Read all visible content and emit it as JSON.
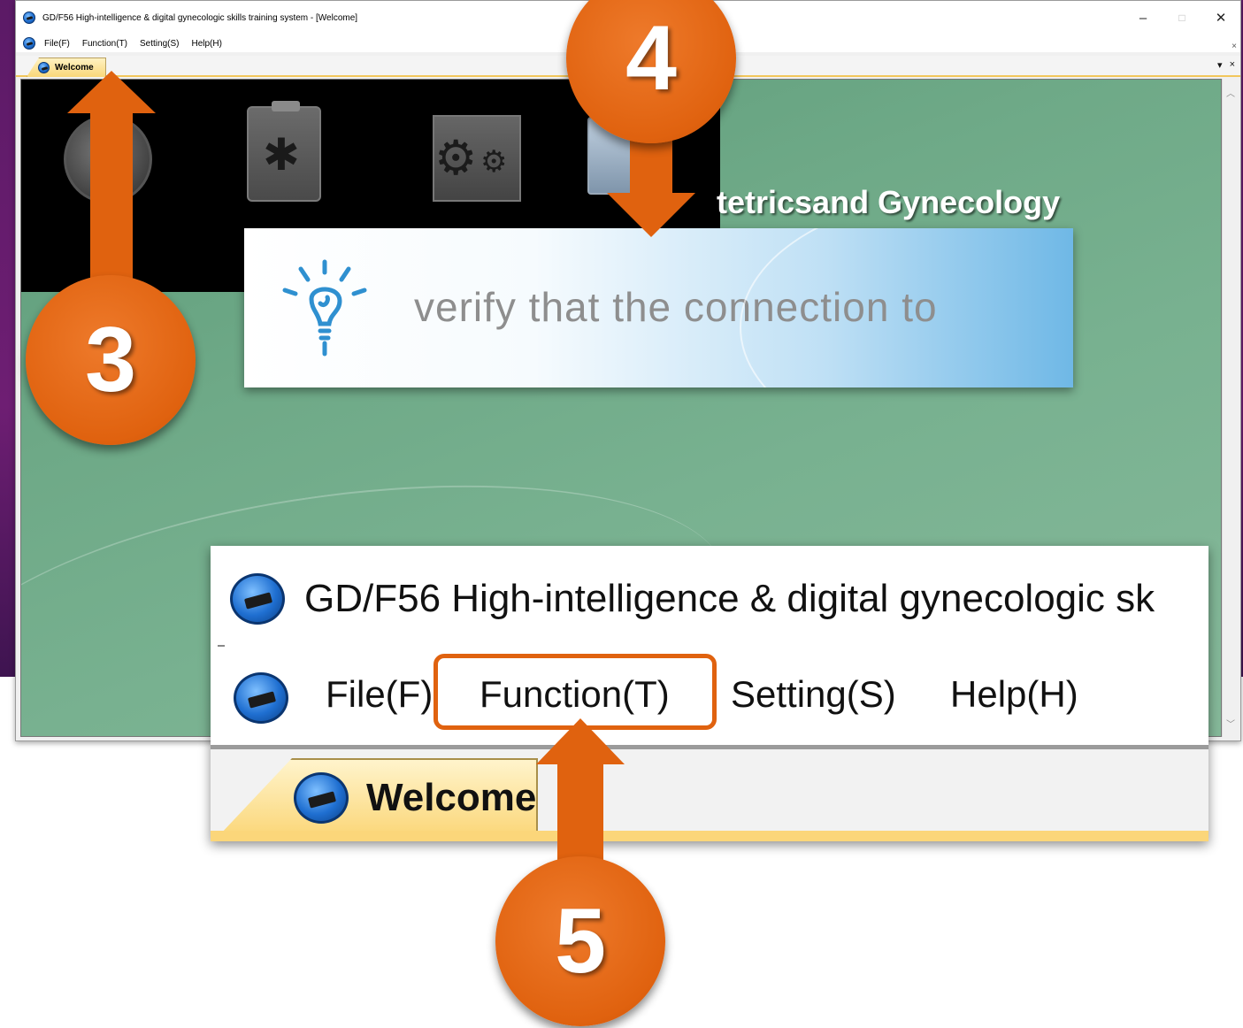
{
  "window": {
    "title": "GD/F56 High-intelligence & digital gynecologic skills training system - [Welcome]",
    "minimize_glyph": "–",
    "maximize_glyph": "□",
    "close_glyph": "✕",
    "mdi_close_glyph": "×"
  },
  "menu": {
    "items": [
      {
        "label": "File(F)"
      },
      {
        "label": "Function(T)"
      },
      {
        "label": "Setting(S)"
      },
      {
        "label": "Help(H)"
      }
    ]
  },
  "tabs": {
    "active_label": "Welcome",
    "dropdown_glyph": "▾",
    "close_glyph": "×"
  },
  "content": {
    "heading": "tetricsand Gynecology",
    "icons": [
      "connection-icon",
      "medical-record-icon",
      "settings-icon",
      "document-icon"
    ]
  },
  "callouts": {
    "verify_text": "verify that the connection to",
    "zoom_title": "GD/F56 High-intelligence & digital gynecologic sk",
    "zoom_menu": [
      "File(F)",
      "Function(T)",
      "Setting(S)",
      "Help(H)"
    ],
    "zoom_tab": "Welcome"
  },
  "steps": [
    {
      "number": "3"
    },
    {
      "number": "4"
    },
    {
      "number": "5"
    }
  ],
  "colors": {
    "accent_orange": "#e0620f",
    "desktop_purple": "#5b1a66",
    "client_green": "#6ea987",
    "tab_yellow": "#fbd77a"
  }
}
